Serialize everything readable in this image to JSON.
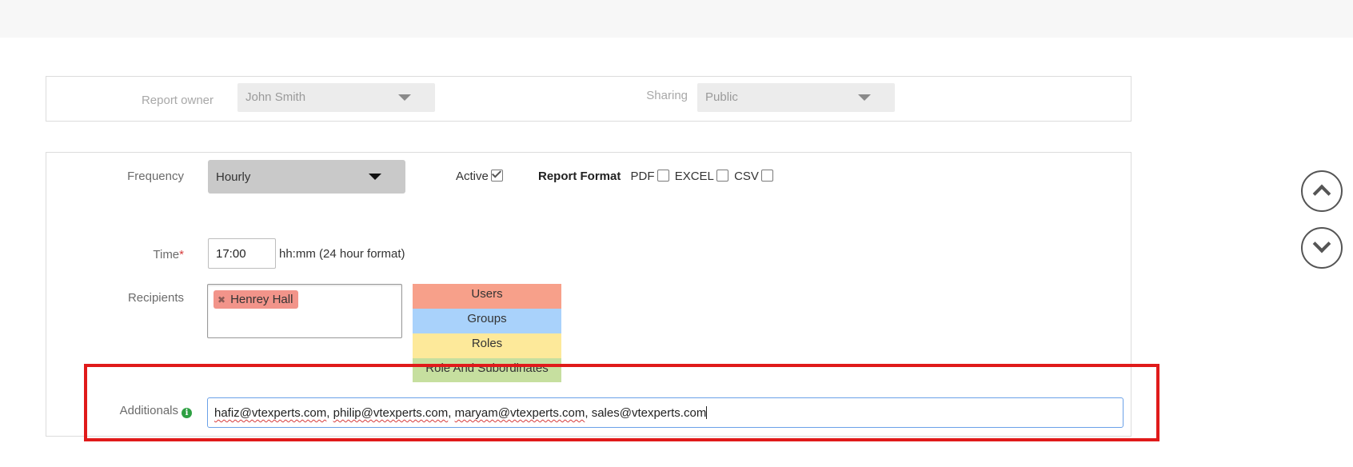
{
  "owner_panel": {
    "report_owner_label": "Report owner",
    "report_owner_value": "John Smith",
    "sharing_label": "Sharing",
    "sharing_value": "Public"
  },
  "schedule": {
    "frequency_label": "Frequency",
    "frequency_value": "Hourly",
    "active_label": "Active",
    "active_checked": true,
    "report_format_label": "Report Format",
    "formats": [
      {
        "label": "PDF",
        "checked": false
      },
      {
        "label": "EXCEL",
        "checked": false
      },
      {
        "label": "CSV",
        "checked": false
      }
    ],
    "time_label": "Time",
    "time_required_mark": "*",
    "time_value": "17:00",
    "time_hint": "hh:mm (24 hour format)",
    "recipients_label": "Recipients",
    "recipients": [
      "Henrey Hall"
    ],
    "recipient_types": [
      {
        "label": "Users",
        "color": "#f7a08a"
      },
      {
        "label": "Groups",
        "color": "#a9d2fb"
      },
      {
        "label": "Roles",
        "color": "#fde99a"
      },
      {
        "label": "Role And Subordinates",
        "color": "#c6df9f"
      }
    ],
    "additionals_label": "Additionals",
    "additionals_emails": [
      "hafiz@vtexperts.com",
      "philip@vtexperts.com",
      "maryam@vtexperts.com",
      "sales@vtexperts.com"
    ]
  },
  "colors": {
    "highlight": "#e01a1a",
    "token": "#f2948a",
    "info_icon": "#2ea043",
    "focus_border": "#6aa1e8"
  },
  "icons": {
    "info": "info-circle-icon",
    "scroll_up": "chevron-up-icon",
    "scroll_down": "chevron-down-icon",
    "token_remove": "close-icon"
  }
}
